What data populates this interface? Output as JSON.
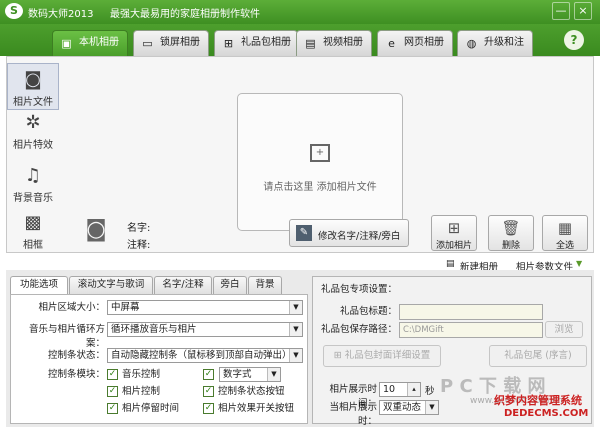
{
  "app": {
    "name": "数码大师2013",
    "slogan": "最强大最易用的家庭相册制作软件"
  },
  "window_buttons": {
    "minimize": "—",
    "close": "×"
  },
  "tabs": [
    {
      "label": "本机相册"
    },
    {
      "label": "锁屏相册"
    },
    {
      "label": "礼品包相册"
    },
    {
      "label": "视频相册"
    },
    {
      "label": "网页相册"
    },
    {
      "label": "升级和注册"
    }
  ],
  "help_label": "?",
  "sidebar": [
    {
      "label": "相片文件"
    },
    {
      "label": "相片特效"
    },
    {
      "label": "背景音乐"
    },
    {
      "label": "相框"
    }
  ],
  "dropzone": {
    "text": "请点击这里 添加相片文件"
  },
  "info": {
    "name_label": "名字:",
    "comment_label": "注释:"
  },
  "buttons": {
    "edit": "修改名字/注释/旁白",
    "add": "添加相片",
    "delete": "删除",
    "select_all": "全选"
  },
  "menu": {
    "new": "新建相册",
    "params": "相片参数文件"
  },
  "bottom_tabs": [
    {
      "label": "功能选项"
    },
    {
      "label": "滚动文字与歌词"
    },
    {
      "label": "名字/注释"
    },
    {
      "label": "旁白"
    },
    {
      "label": "背景"
    }
  ],
  "options": {
    "area_label": "相片区域大小：",
    "area_value": "中屏幕",
    "loop_label": "音乐与相片循环方案：",
    "loop_value": "循环播放音乐与相片",
    "ctrl_label": "控制条状态：",
    "ctrl_value": "自动隐藏控制条（鼠标移到顶部自动弹出）",
    "module_label": "控制条模块：",
    "checks": [
      "音乐控制",
      "数字式",
      "相片控制",
      "控制条状态按钮",
      "相片停留时间",
      "相片效果开关按钮"
    ]
  },
  "gift": {
    "header": "礼品包专项设置：",
    "title_label": "礼品包标题：",
    "path_label": "礼品包保存路径：",
    "path_value": "C:\\DMGift",
    "browse": "浏览",
    "cover_btn": "礼品包封面详细设置",
    "tail_btn": "礼品包尾 (序言)",
    "interval_label": "相片展示时间：",
    "interval_value": "10",
    "interval_unit": "秒",
    "effect_label": "当相片展示时：",
    "effect_value": "双重动态"
  },
  "watermark": {
    "line1": "P C 下 载 网",
    "line2": "www.pc6soft.com.cn",
    "line3": "织梦内容管理系统",
    "line4": "DEDECMS.COM"
  }
}
